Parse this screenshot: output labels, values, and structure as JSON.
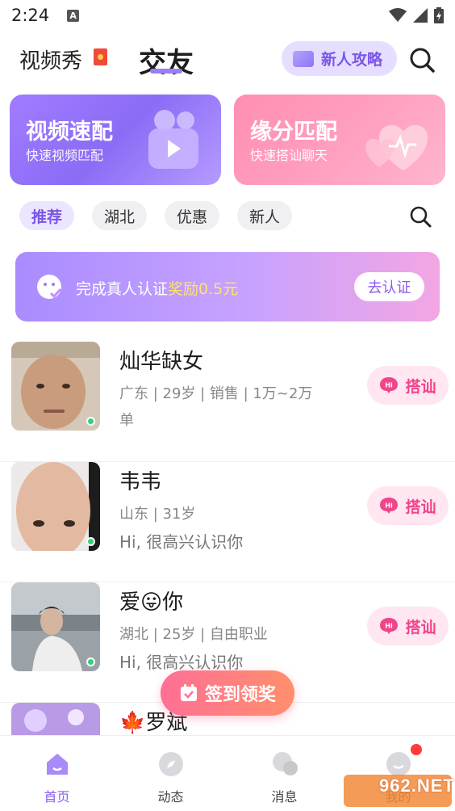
{
  "status_bar": {
    "time": "2:24",
    "notification_letter": "A"
  },
  "header": {
    "tab_video": "视频秀",
    "tab_friends": "交友",
    "newbie_label": "新人攻略"
  },
  "cards": [
    {
      "title": "视频速配",
      "subtitle": "快速视频匹配"
    },
    {
      "title": "缘分匹配",
      "subtitle": "快速搭讪聊天"
    }
  ],
  "filters": [
    "推荐",
    "湖北",
    "优惠",
    "新人"
  ],
  "verify_banner": {
    "text": "完成真人认证",
    "reward": "奖励0.5元",
    "button": "去认证"
  },
  "users": [
    {
      "name": "灿华缺女",
      "meta": "广东 | 29岁 | 销售 | 1万~2万单",
      "greeting": "",
      "online": true,
      "chat_label": "搭讪"
    },
    {
      "name": "韦韦",
      "meta": "山东 | 31岁",
      "greeting": "Hi, 很高兴认识你",
      "online": true,
      "chat_label": "搭讪"
    },
    {
      "name": "爱😛你",
      "meta": "湖北 | 25岁 | 自由职业",
      "greeting": "Hi, 很高兴认识你",
      "online": true,
      "chat_label": "搭讪"
    },
    {
      "name": "🍁罗斌",
      "meta": "",
      "greeting": "",
      "online": false,
      "chat_label": ""
    }
  ],
  "signin": {
    "label": "签到领奖"
  },
  "bottom_nav": [
    {
      "label": "首页",
      "icon": "home-icon",
      "active": true
    },
    {
      "label": "动态",
      "icon": "compass-icon",
      "active": false
    },
    {
      "label": "消息",
      "icon": "chat-bubbles-icon",
      "active": false
    },
    {
      "label": "我的",
      "icon": "profile-icon",
      "active": false
    }
  ],
  "watermark": "962.NET",
  "colors": {
    "accent": "#8a5cf2",
    "pink": "#f0448b",
    "online": "#35d07a"
  }
}
